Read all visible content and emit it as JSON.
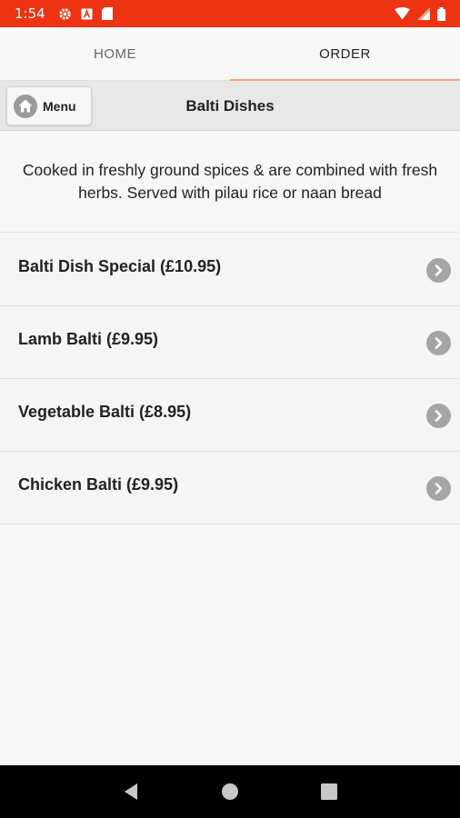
{
  "status_bar": {
    "time": "1:54",
    "left_icons": [
      "gear-icon",
      "text-icon",
      "sd-card-icon"
    ],
    "right_icons": [
      "wifi-icon",
      "signal-icon",
      "battery-icon"
    ],
    "bg_color": "#ee3312"
  },
  "tabs": [
    {
      "label": "HOME",
      "active": false
    },
    {
      "label": "ORDER",
      "active": true
    }
  ],
  "toolbar": {
    "menu_label": "Menu",
    "title": "Balti Dishes"
  },
  "description": "Cooked in freshly ground spices & are combined with fresh herbs. Served with pilau rice or naan bread",
  "dishes": [
    {
      "name": "Balti Dish Special (£10.95)"
    },
    {
      "name": "Lamb Balti (£9.95)"
    },
    {
      "name": "Vegetable Balti (£8.95)"
    },
    {
      "name": "Chicken Balti (£9.95)"
    }
  ],
  "nav_bar": {
    "buttons": [
      "back-icon",
      "home-icon",
      "recents-icon"
    ]
  },
  "colors": {
    "accent": "#ee3312",
    "tab_indicator": "#f4a47a",
    "chevron": "#a5a5a5"
  }
}
